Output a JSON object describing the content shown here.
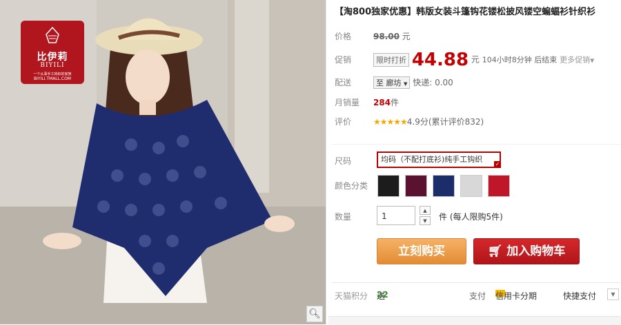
{
  "brand": {
    "cn": "比伊莉",
    "en": "BIYILI",
    "tagline": "一个从事手工钩织的家族",
    "url": "BIYILI.TMALL.COM"
  },
  "product": {
    "title": "【淘800独家优惠】韩版女装斗篷钩花镂松披风镂空蝙蝠衫针织衫",
    "price_label": "价格",
    "orig_price": "98.00",
    "yuan": "元",
    "promo_label": "促销",
    "promo_tag": "限时打折",
    "promo_price": "44.88",
    "promo_yuan": "元",
    "countdown": "104小时8分钟 后结束",
    "more_promo": "更多促销",
    "ship_label": "配送",
    "ship_to": "至 廊坊",
    "express": "快递: 0.00",
    "sales_label": "月销量",
    "sales": "284",
    "sales_unit": "件",
    "rating_label": "评价",
    "stars": "★★★★★",
    "rating": "4.9分(累计评价832)",
    "size_label": "尺码",
    "size_value": "均码（不配打底衫)纯手工钩织",
    "color_label": "颜色分类",
    "swatch_colors": [
      "#1c1c1c",
      "#5a1230",
      "#1b2d6b",
      "#d8d8d8",
      "#c0162a"
    ],
    "qty_label": "数量",
    "qty": "1",
    "qty_unit": "件 (每人限购5件)",
    "buy_label": "立刻购买",
    "cart_label": "加入购物车"
  },
  "footer": {
    "points_label": "天猫积分",
    "points_prefix": "送",
    "points": "22",
    "pay_label": "支付",
    "credit": "信用卡分期",
    "quick": "快捷支付"
  },
  "icons": {
    "zoom": "search-icon",
    "cart": "cart-icon",
    "dropdown": "chevron-down-icon"
  }
}
